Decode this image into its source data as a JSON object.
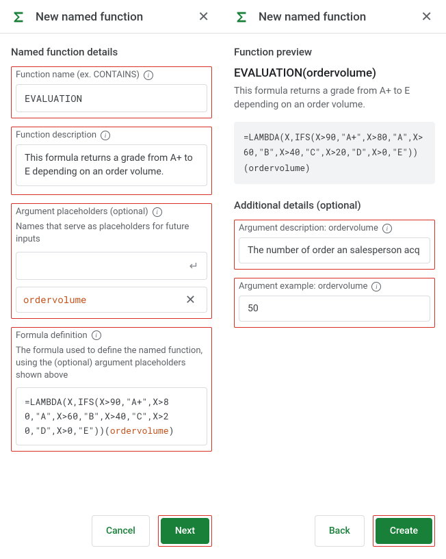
{
  "leftPanel": {
    "title": "New named function",
    "sectionHeading": "Named function details",
    "functionName": {
      "label": "Function name (ex. CONTAINS)",
      "value": "EVALUATION"
    },
    "functionDescription": {
      "label": "Function description",
      "value": "This formula returns a grade from A+ to E depending on an order volume."
    },
    "argumentPlaceholders": {
      "label": "Argument placeholders (optional)",
      "sublabel": "Names that serve as placeholders for future inputs",
      "chip": "ordervolume"
    },
    "formulaDefinition": {
      "label": "Formula definition",
      "sublabel": "The formula used to define the named function, using the (optional) argument placeholders shown above",
      "prefix": "=LAMBDA(X,IFS(X>90,\"A+\",X>80,\"A\",X>60,\"B\",X>40,\"C\",X>20,\"D\",X>0,\"E\")",
      "open": ")(",
      "arg": "ordervolume",
      "close": ")"
    },
    "footer": {
      "cancel": "Cancel",
      "next": "Next"
    }
  },
  "rightPanel": {
    "title": "New named function",
    "sectionHeading": "Function preview",
    "previewTitle": "EVALUATION(ordervolume)",
    "previewDescription": "This formula returns a grade from A+ to E depending on an order volume.",
    "codeBlock": "=LAMBDA(X,IFS(X>90,\"A+\",X>80,\"A\",X>60,\"B\",X>40,\"C\",X>20,\"D\",X>0,\"E\"))(ordervolume)",
    "additionalDetailsHeading": "Additional details (optional)",
    "argumentDescription": {
      "label": "Argument description: ordervolume",
      "value": "The number of order an salesperson acq"
    },
    "argumentExample": {
      "label": "Argument example: ordervolume",
      "value": "50"
    },
    "footer": {
      "back": "Back",
      "create": "Create"
    }
  }
}
